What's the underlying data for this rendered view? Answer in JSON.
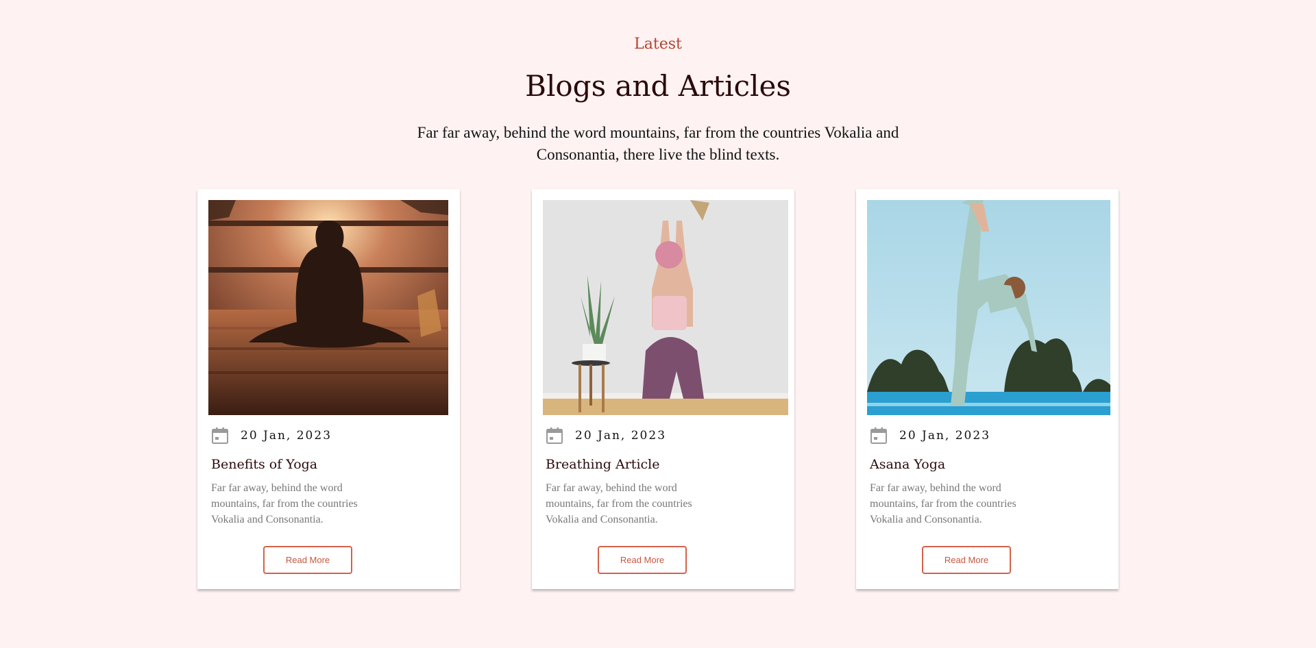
{
  "section": {
    "eyebrow": "Latest",
    "title": "Blogs and Articles",
    "subtitle": "Far far away, behind the word mountains, far from the countries Vokalia and Consonantia, there live the blind texts."
  },
  "colors": {
    "background": "#fff2f2",
    "accent": "#d4624a",
    "heading": "#2a0a0a"
  },
  "posts": [
    {
      "image_icon": "yoga-meditation-photo",
      "date_icon": "calendar-icon",
      "date": "20 Jan, 2023",
      "title": "Benefits of Yoga",
      "excerpt": "Far far away, behind the word mountains, far from the countries Vokalia and Consonantia.",
      "button_label": "Read More"
    },
    {
      "image_icon": "yoga-breathing-photo",
      "date_icon": "calendar-icon",
      "date": "20 Jan, 2023",
      "title": "Breathing Article",
      "excerpt": "Far far away, behind the word mountains, far from the countries Vokalia and Consonantia.",
      "button_label": "Read More"
    },
    {
      "image_icon": "asana-yoga-photo",
      "date_icon": "calendar-icon",
      "date": "20 Jan, 2023",
      "title": "Asana Yoga",
      "excerpt": "Far far away, behind the word mountains, far from the countries Vokalia and Consonantia.",
      "button_label": "Read More"
    }
  ]
}
